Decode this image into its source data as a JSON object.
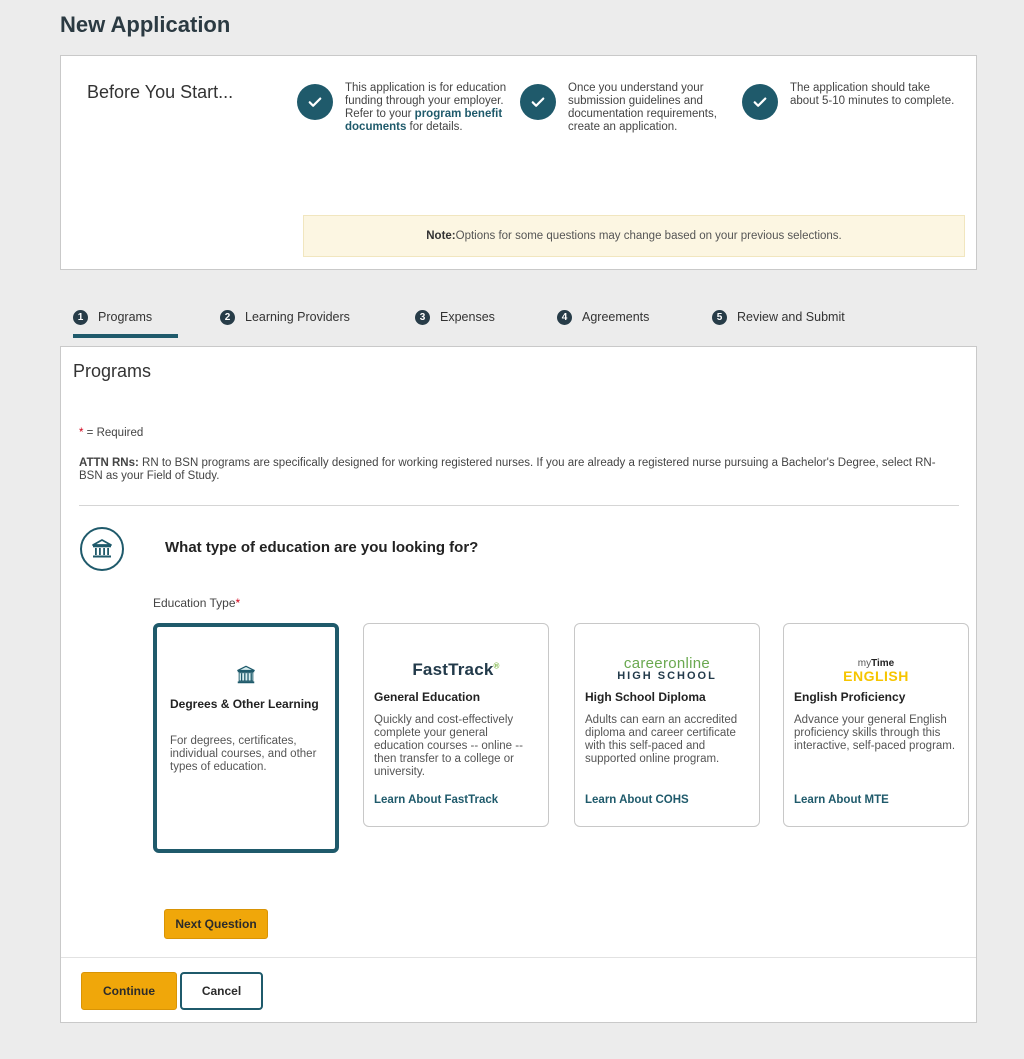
{
  "page": {
    "title": "New Application"
  },
  "before_you_start": {
    "heading": "Before You Start...",
    "steps": [
      {
        "text_before_link": "This application is for education funding through your employer. Refer to your ",
        "link": "program benefit documents",
        "text_after_link": " for details."
      },
      {
        "text": "Once you understand your submission guidelines and documentation requirements, create an application."
      },
      {
        "text": "The application should take about 5-10 minutes to complete."
      }
    ],
    "note_label": "Note:",
    "note_text": " Options for some questions may change based on your previous selections."
  },
  "tabs": [
    {
      "num": "1",
      "label": "Programs",
      "active": true
    },
    {
      "num": "2",
      "label": "Learning Providers"
    },
    {
      "num": "3",
      "label": "Expenses"
    },
    {
      "num": "4",
      "label": "Agreements"
    },
    {
      "num": "5",
      "label": "Review and Submit"
    }
  ],
  "programs": {
    "title": "Programs",
    "required_star": "*",
    "required_text": " = Required",
    "attn_label": "ATTN RNs:",
    "attn_text": " RN to BSN programs are specifically designed for working registered nurses. If you are already a registered nurse pursuing a Bachelor's Degree, select RN-BSN as your Field of Study.",
    "question": "What type of education are you looking for?",
    "education_type_label": "Education Type",
    "education_type_star": "*",
    "cards": [
      {
        "title": "Degrees & Other Learning",
        "desc": "For degrees, certificates, individual courses, and other types of education.",
        "selected": true
      },
      {
        "logo": "FastTrack",
        "logo_mark": "®",
        "title": "General Education",
        "desc": "Quickly and cost-effectively complete your general education courses -- online -- then transfer to a college or university.",
        "link": "Learn About FastTrack"
      },
      {
        "logo_top": "careeronline",
        "logo_bottom": "HIGH SCHOOL",
        "title": "High School Diploma",
        "desc": "Adults can earn an accredited diploma and career certificate with this self-paced and supported online program.",
        "link": "Learn About COHS"
      },
      {
        "logo_top_prefix": "my",
        "logo_top_main": "Time",
        "logo_bottom": "ENGLISH",
        "title": "English Proficiency",
        "desc": "Advance your general English proficiency skills through this interactive, self-paced program.",
        "link": "Learn About MTE"
      }
    ],
    "next_question_label": "Next Question"
  },
  "footer": {
    "continue_label": "Continue",
    "cancel_label": "Cancel"
  },
  "colors": {
    "accent": "#1f5a6b",
    "button": "#f0a70a",
    "note_bg": "#fcf6e2",
    "required": "#d0021b"
  }
}
